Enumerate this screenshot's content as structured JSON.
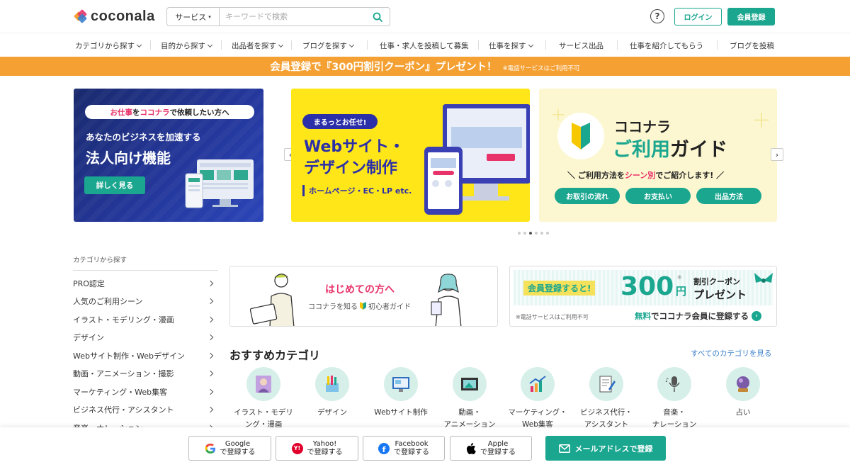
{
  "header": {
    "logo_text": "coconala",
    "search_category": "サービス",
    "search_placeholder": "キーワードで検索",
    "help_label": "?",
    "login_label": "ログイン",
    "signup_label": "会員登録"
  },
  "nav": [
    "カテゴリから探す",
    "目的から探す",
    "出品者を探す",
    "ブログを探す",
    "仕事・求人を投稿して募集",
    "仕事を探す",
    "サービス出品",
    "仕事を紹介してもらう",
    "ブログを投稿"
  ],
  "promo": {
    "text": "会員登録で『300円割引クーポン』プレゼント！",
    "note": "※電話サービスはご利用不可"
  },
  "banners": {
    "b1": {
      "pill": "お仕事をココナラで依頼したい方へ",
      "pill_a": "お仕事",
      "pill_b": "を",
      "pill_c": "ココナラ",
      "pill_d": "で依頼したい方へ",
      "sub": "あなたのビジネスを加速する",
      "title": "法人向け機能",
      "button": "詳しく見る"
    },
    "b2": {
      "tag": "まるっとお任せ!",
      "title1": "Webサイト・",
      "title2": "デザイン制作",
      "sub": "ホームページ・EC・LP etc."
    },
    "b3": {
      "title1": "ココナラ",
      "title2a": "ご利用",
      "title2b": "ガイド",
      "sub_a": "ご利用方法を",
      "sub_b": "シーン別",
      "sub_c": "でご紹介します!",
      "buttons": [
        "お取引の流れ",
        "お支払い",
        "出品方法"
      ]
    }
  },
  "carousel": {
    "dots": 6,
    "active_index": 3
  },
  "sidebar": {
    "title": "カテゴリから探す",
    "items": [
      "PRO認定",
      "人気のご利用シーン",
      "イラスト・モデリング・漫画",
      "デザイン",
      "Webサイト制作・Webデザイン",
      "動画・アニメーション・撮影",
      "マーケティング・Web集客",
      "ビジネス代行・アシスタント",
      "音楽・ナレーション"
    ]
  },
  "card_first": {
    "title": "はじめての方へ",
    "sub": "ココナラを知る",
    "sub2": "初心者ガイド"
  },
  "card_coupon": {
    "reg": "会員登録すると!",
    "amount": "300",
    "yen": "円",
    "mark": "※",
    "coupon1": "割引クーポン",
    "coupon2": "プレゼント",
    "note": "※電話サービスはご利用不可",
    "cta_a": "無料",
    "cta_b": "でココナラ会員に登録する"
  },
  "recommend": {
    "title": "おすすめカテゴリ",
    "see_all": "すべてのカテゴリを見る",
    "categories": [
      {
        "label": "イラスト・モデリ\nング・漫画",
        "icon": "illustration-icon"
      },
      {
        "label": "デザイン",
        "icon": "design-icon"
      },
      {
        "label": "Webサイト制作",
        "icon": "web-icon"
      },
      {
        "label": "動画・\nアニメーション",
        "icon": "video-icon"
      },
      {
        "label": "マーケティング・\nWeb集客",
        "icon": "marketing-icon"
      },
      {
        "label": "ビジネス代行・\nアシスタント",
        "icon": "business-icon"
      },
      {
        "label": "音楽・\nナレーション",
        "icon": "music-icon"
      },
      {
        "label": "占い",
        "icon": "fortune-icon"
      }
    ]
  },
  "signup_bar": {
    "google": "Google\nで登録する",
    "yahoo": "Yahoo!\nで登録する",
    "facebook": "Facebook\nで登録する",
    "apple": "Apple\nで登録する",
    "mail": "メールアドレスで登録"
  },
  "colors": {
    "brand_green": "#1aa68f",
    "promo_orange": "#f5a033",
    "link_blue": "#3b7fcb",
    "accent_pink": "#e8336a"
  }
}
